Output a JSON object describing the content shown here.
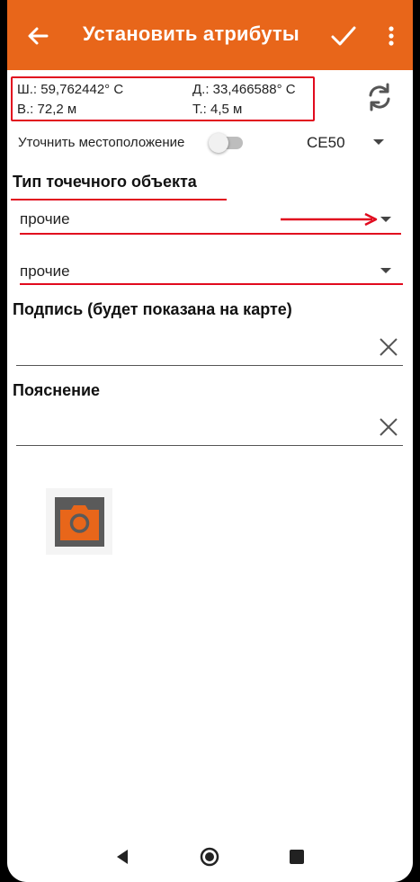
{
  "app_bar": {
    "title": "Установить атрибуты",
    "background": "#e8661a",
    "icons": [
      "back-arrow-icon",
      "check-icon",
      "more-vert-icon"
    ]
  },
  "location": {
    "lat": "Ш.: 59,762442° С",
    "lon": "Д.: 33,466588° С",
    "alt": "В.: 72,2 м",
    "acc": "Т.: 4,5 м"
  },
  "refine": {
    "label": "Уточнить местоположение",
    "toggle_on": false,
    "ce_value": "CE50"
  },
  "point_type": {
    "title": "Тип точечного объекта",
    "select1": "прочие",
    "select2": "прочие"
  },
  "caption": {
    "label": "Подпись (будет показана на карте)",
    "value": ""
  },
  "note": {
    "label": "Пояснение",
    "value": ""
  },
  "colors": {
    "accent": "#e8661a",
    "annotation_red": "#e10a1e"
  }
}
